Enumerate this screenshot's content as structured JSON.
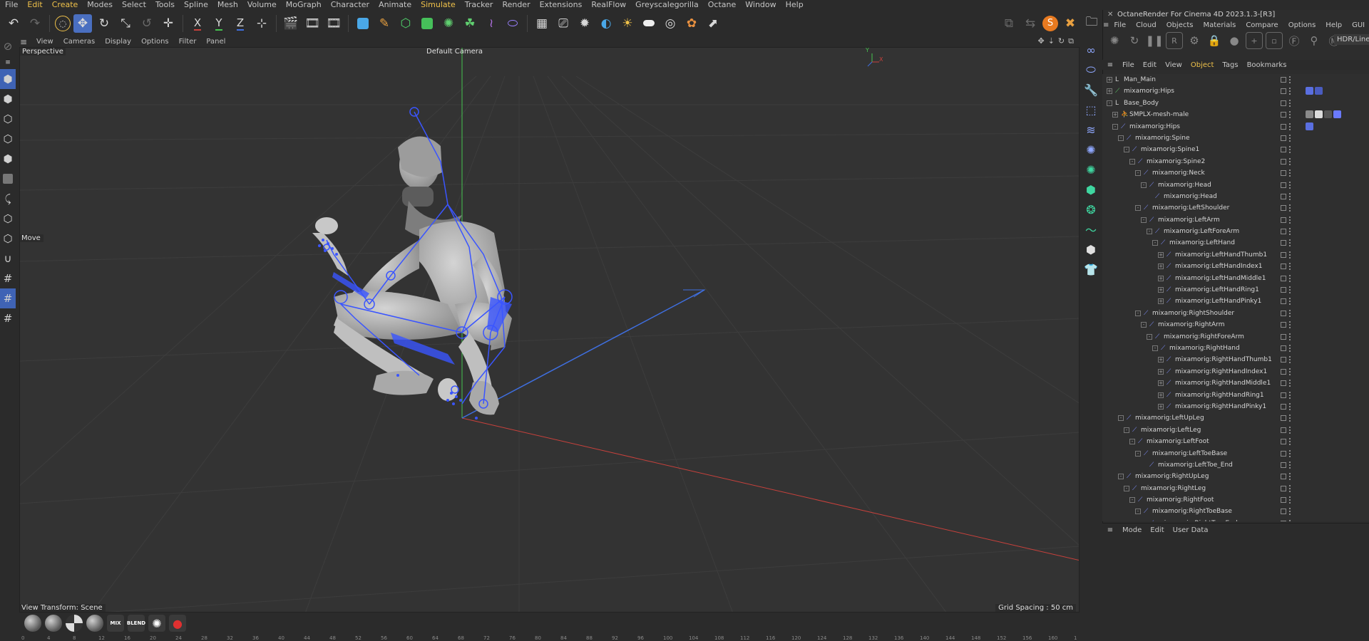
{
  "menubar": [
    "File",
    "Edit",
    "Create",
    "Modes",
    "Select",
    "Tools",
    "Spline",
    "Mesh",
    "Volume",
    "MoGraph",
    "Character",
    "Animate",
    "Simulate",
    "Tracker",
    "Render",
    "Extensions",
    "RealFlow",
    "Greyscalegorilla",
    "Octane",
    "Window",
    "Help"
  ],
  "menubar_highlight": [
    "Edit",
    "Create",
    "Simulate"
  ],
  "toolbar": {
    "icons": [
      "undo-icon",
      "redo-icon",
      "live-selection-icon",
      "move-icon",
      "rotate-icon",
      "scale-icon",
      "recent-tools-icon",
      "model-icon",
      "x-axis-icon",
      "y-axis-icon",
      "z-axis-icon",
      "coordinate-system-icon",
      "render-view-icon",
      "render-active-icon",
      "render-settings-icon",
      "cube-icon",
      "pen-icon",
      "subdivision-icon",
      "cloner-icon",
      "gear-icon",
      "mograph-icon",
      "deformer-icon",
      "field-icon",
      "grid-icon",
      "camera-icon",
      "light-icon",
      "shader-icon",
      "sky-icon",
      "floor-icon",
      "ring-icon",
      "render-queue-icon",
      "export-icon"
    ],
    "axis_labels": {
      "x": "X",
      "y": "Y",
      "z": "Z"
    }
  },
  "viewport_menu": [
    "View",
    "Cameras",
    "Display",
    "Options",
    "Filter",
    "Panel"
  ],
  "viewport": {
    "view_name": "Perspective",
    "camera_name": "Default Camera",
    "tool_label": "Move",
    "view_transform": "View Transform: Scene",
    "grid_spacing": "Grid Spacing : 50 cm",
    "axis_y": "Y",
    "axis_x": "X"
  },
  "timeline": {
    "material_balls": [
      "",
      "",
      "",
      "",
      "MIX",
      "BLEND",
      "",
      "●"
    ],
    "ruler": [
      "0",
      "4",
      "8",
      "12",
      "16",
      "20",
      "24",
      "28",
      "32",
      "36",
      "40",
      "44",
      "48",
      "52",
      "56",
      "60",
      "64",
      "68",
      "72",
      "76",
      "80",
      "84",
      "88",
      "92",
      "96",
      "100",
      "104",
      "108",
      "112",
      "116",
      "120",
      "124",
      "128",
      "132",
      "136",
      "140",
      "144",
      "148",
      "152",
      "156",
      "160",
      "1"
    ]
  },
  "octane": {
    "title": "OctaneRender For Cinema 4D 2023.1.3-[R3]",
    "menu": [
      "File",
      "Cloud",
      "Objects",
      "Materials",
      "Compare",
      "Options",
      "Help",
      "GUI"
    ],
    "hdr_label": "HDR/Linear"
  },
  "object_manager": {
    "menu": [
      "File",
      "Edit",
      "View",
      "Object",
      "Tags",
      "Bookmarks"
    ],
    "active_menu": "Object",
    "rows": [
      {
        "name": "Man_Main",
        "depth": 0,
        "exp": "+",
        "icon": "null"
      },
      {
        "name": "mixamorig:Hips",
        "depth": 0,
        "exp": "+",
        "icon": "joint-green"
      },
      {
        "name": "Base_Body",
        "depth": 0,
        "exp": "-",
        "icon": "null"
      },
      {
        "name": "SMPLX-mesh-male",
        "depth": 1,
        "exp": "+",
        "icon": "mesh"
      },
      {
        "name": "mixamorig:Hips",
        "depth": 1,
        "exp": "-",
        "icon": "joint"
      },
      {
        "name": "mixamorig:Spine",
        "depth": 2,
        "exp": "-",
        "icon": "joint"
      },
      {
        "name": "mixamorig:Spine1",
        "depth": 3,
        "exp": "-",
        "icon": "joint"
      },
      {
        "name": "mixamorig:Spine2",
        "depth": 4,
        "exp": "-",
        "icon": "joint"
      },
      {
        "name": "mixamorig:Neck",
        "depth": 5,
        "exp": "-",
        "icon": "joint"
      },
      {
        "name": "mixamorig:Head",
        "depth": 6,
        "exp": "-",
        "icon": "joint"
      },
      {
        "name": "mixamorig:Head",
        "depth": 7,
        "exp": "",
        "icon": "joint"
      },
      {
        "name": "mixamorig:LeftShoulder",
        "depth": 5,
        "exp": "-",
        "icon": "joint"
      },
      {
        "name": "mixamorig:LeftArm",
        "depth": 6,
        "exp": "-",
        "icon": "joint"
      },
      {
        "name": "mixamorig:LeftForeArm",
        "depth": 7,
        "exp": "-",
        "icon": "joint"
      },
      {
        "name": "mixamorig:LeftHand",
        "depth": 8,
        "exp": "-",
        "icon": "joint"
      },
      {
        "name": "mixamorig:LeftHandThumb1",
        "depth": 9,
        "exp": "+",
        "icon": "joint"
      },
      {
        "name": "mixamorig:LeftHandIndex1",
        "depth": 9,
        "exp": "+",
        "icon": "joint"
      },
      {
        "name": "mixamorig:LeftHandMiddle1",
        "depth": 9,
        "exp": "+",
        "icon": "joint"
      },
      {
        "name": "mixamorig:LeftHandRing1",
        "depth": 9,
        "exp": "+",
        "icon": "joint"
      },
      {
        "name": "mixamorig:LeftHandPinky1",
        "depth": 9,
        "exp": "+",
        "icon": "joint"
      },
      {
        "name": "mixamorig:RightShoulder",
        "depth": 5,
        "exp": "-",
        "icon": "joint"
      },
      {
        "name": "mixamorig:RightArm",
        "depth": 6,
        "exp": "-",
        "icon": "joint"
      },
      {
        "name": "mixamorig:RightForeArm",
        "depth": 7,
        "exp": "-",
        "icon": "joint"
      },
      {
        "name": "mixamorig:RightHand",
        "depth": 8,
        "exp": "-",
        "icon": "joint"
      },
      {
        "name": "mixamorig:RightHandThumb1",
        "depth": 9,
        "exp": "+",
        "icon": "joint"
      },
      {
        "name": "mixamorig:RightHandIndex1",
        "depth": 9,
        "exp": "+",
        "icon": "joint"
      },
      {
        "name": "mixamorig:RightHandMiddle1",
        "depth": 9,
        "exp": "+",
        "icon": "joint"
      },
      {
        "name": "mixamorig:RightHandRing1",
        "depth": 9,
        "exp": "+",
        "icon": "joint"
      },
      {
        "name": "mixamorig:RightHandPinky1",
        "depth": 9,
        "exp": "+",
        "icon": "joint"
      },
      {
        "name": "mixamorig:LeftUpLeg",
        "depth": 2,
        "exp": "-",
        "icon": "joint"
      },
      {
        "name": "mixamorig:LeftLeg",
        "depth": 3,
        "exp": "-",
        "icon": "joint"
      },
      {
        "name": "mixamorig:LeftFoot",
        "depth": 4,
        "exp": "-",
        "icon": "joint"
      },
      {
        "name": "mixamorig:LeftToeBase",
        "depth": 5,
        "exp": "-",
        "icon": "joint"
      },
      {
        "name": "mixamorig:LeftToe_End",
        "depth": 6,
        "exp": "",
        "icon": "joint"
      },
      {
        "name": "mixamorig:RightUpLeg",
        "depth": 2,
        "exp": "-",
        "icon": "joint"
      },
      {
        "name": "mixamorig:RightLeg",
        "depth": 3,
        "exp": "-",
        "icon": "joint"
      },
      {
        "name": "mixamorig:RightFoot",
        "depth": 4,
        "exp": "-",
        "icon": "joint"
      },
      {
        "name": "mixamorig:RightToeBase",
        "depth": 5,
        "exp": "-",
        "icon": "joint"
      },
      {
        "name": "mixamorig:RightToe_End",
        "depth": 6,
        "exp": "",
        "icon": "joint"
      }
    ]
  },
  "attributes": {
    "menu": [
      "Mode",
      "Edit",
      "User Data"
    ]
  },
  "colors": {
    "accent_blue": "#4a6fc0",
    "menu_highlight": "#f0c24a",
    "joint_blue": "#3a55ff",
    "x_axis": "#c8413c",
    "y_axis": "#45c44f",
    "z_axis": "#3f6fe0"
  }
}
